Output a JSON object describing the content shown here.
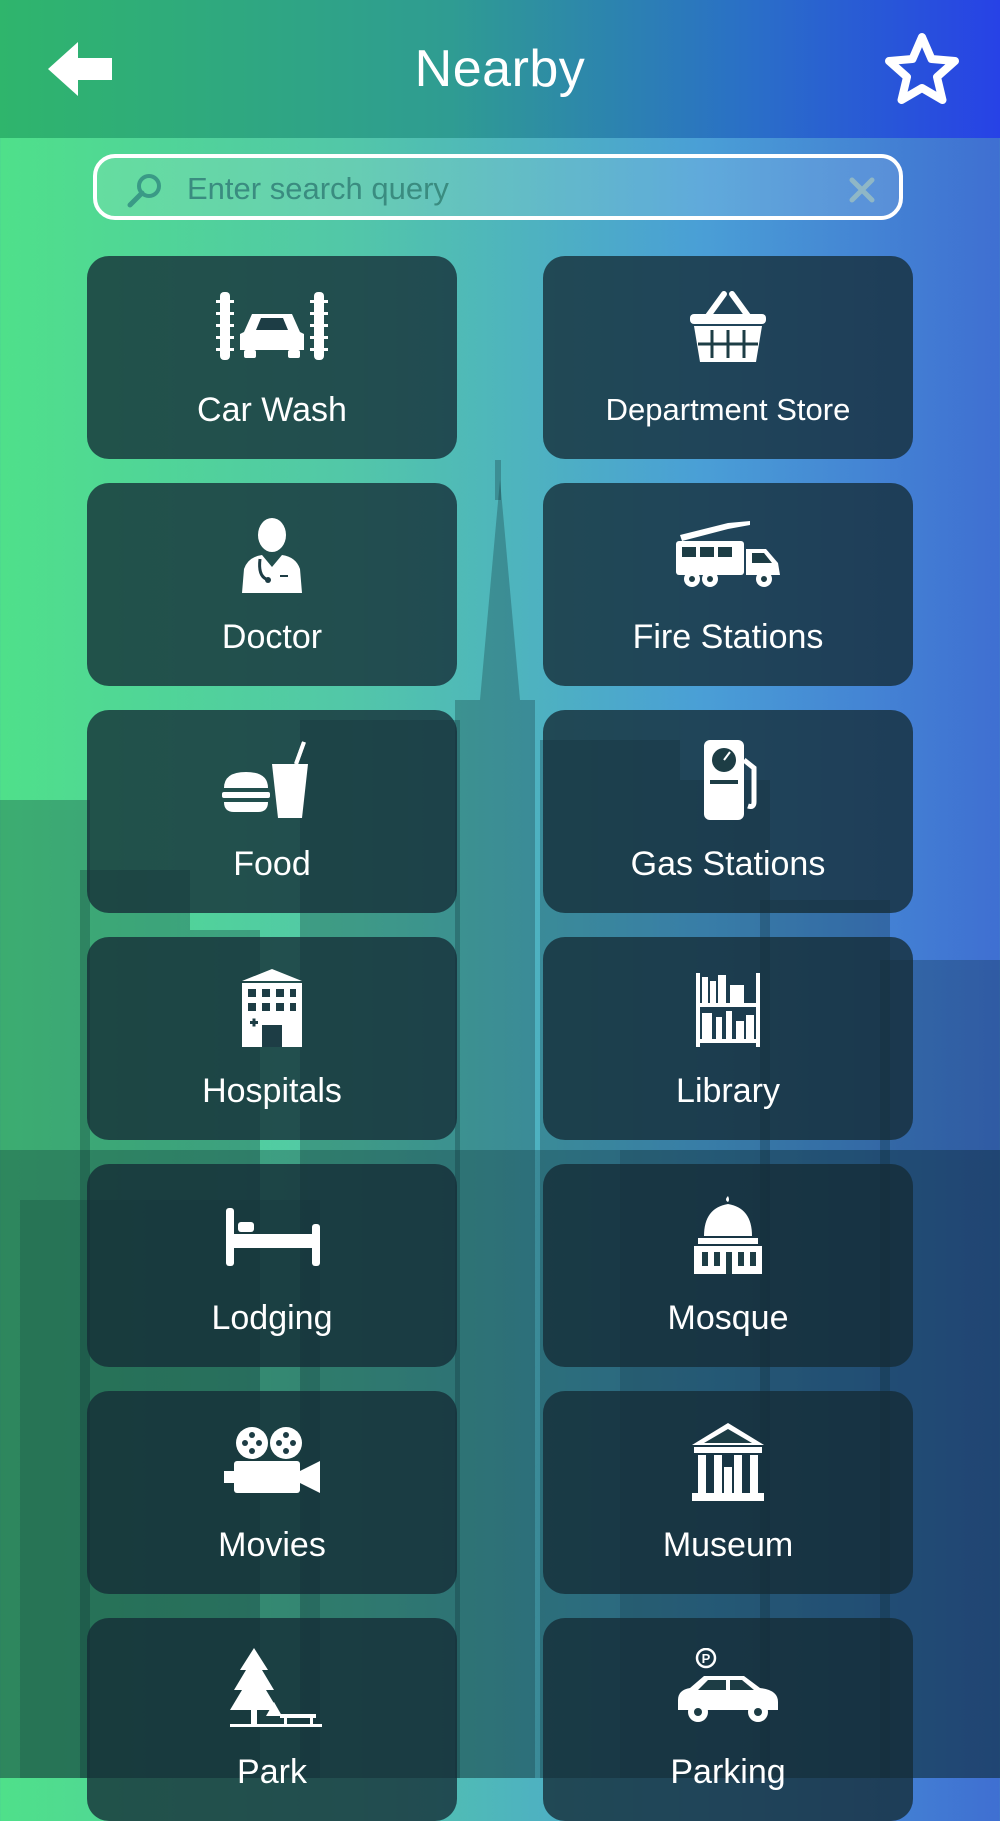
{
  "header": {
    "title": "Nearby",
    "back_icon": "arrow-left-icon",
    "favorite_icon": "star-outline-icon"
  },
  "search": {
    "placeholder": "Enter search query",
    "value": "",
    "search_icon": "magnifier-icon",
    "clear_icon": "close-icon"
  },
  "categories": [
    {
      "label": "Car Wash",
      "icon": "car-wash-icon"
    },
    {
      "label": "Department Store",
      "icon": "basket-icon"
    },
    {
      "label": "Doctor",
      "icon": "doctor-icon"
    },
    {
      "label": "Fire Stations",
      "icon": "fire-truck-icon"
    },
    {
      "label": "Food",
      "icon": "burger-drink-icon"
    },
    {
      "label": "Gas Stations",
      "icon": "fuel-pump-icon"
    },
    {
      "label": "Hospitals",
      "icon": "hospital-icon"
    },
    {
      "label": "Library",
      "icon": "bookshelf-icon"
    },
    {
      "label": "Lodging",
      "icon": "bed-icon"
    },
    {
      "label": "Mosque",
      "icon": "mosque-icon"
    },
    {
      "label": "Movies",
      "icon": "movie-camera-icon"
    },
    {
      "label": "Museum",
      "icon": "museum-icon"
    },
    {
      "label": "Park",
      "icon": "tree-bench-icon"
    },
    {
      "label": "Parking",
      "icon": "parking-car-icon"
    }
  ],
  "colors": {
    "tile_background": "#152c36",
    "header_start": "#2fb56c",
    "header_end": "#2742e6",
    "text": "#ffffff"
  }
}
